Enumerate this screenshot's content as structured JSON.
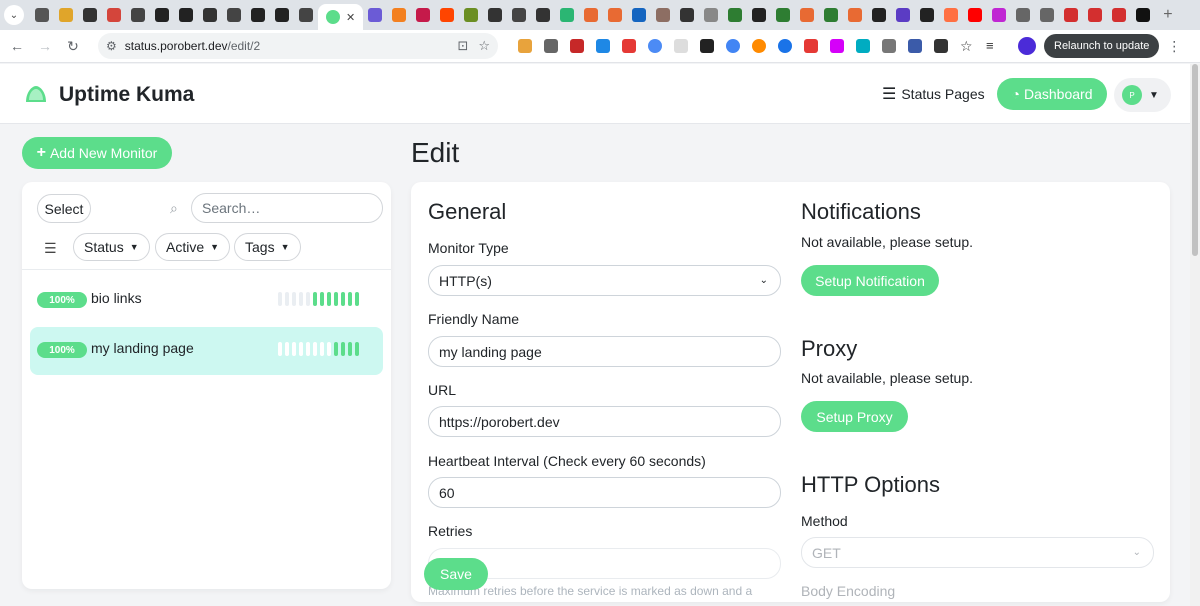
{
  "browser": {
    "tab_close": "✕",
    "url_host": "status.porobert.dev",
    "url_path": "/edit/2",
    "relaunch_label": "Relaunch to update",
    "tab_favicon_colors": [
      "#555",
      "#e0a52a",
      "#333",
      "#d4453b",
      "#444",
      "#222",
      "#222",
      "#333",
      "#444",
      "#222",
      "#222",
      "#444"
    ],
    "extension_colors": [
      "#e8a33c",
      "#666",
      "#c62828",
      "#1e88e5",
      "#e53935",
      "#4c8bf5",
      "#ddd",
      "#222",
      "#4285f4",
      "#ff8a00",
      "#1a73e8",
      "#e53935",
      "#d500f9",
      "#00acc1",
      "#777",
      "#3b5ba9",
      "#333"
    ]
  },
  "header": {
    "app_title": "Uptime Kuma",
    "status_pages_label": "Status Pages",
    "dashboard_label": "Dashboard",
    "avatar_initial": "P"
  },
  "sidebar": {
    "add_monitor_label": "Add New Monitor",
    "select_label": "Select",
    "search_placeholder": "Search…",
    "filters": {
      "status": "Status",
      "active": "Active",
      "tags": "Tags"
    },
    "monitors": [
      {
        "name": "bio links",
        "uptime": "100%",
        "selected": false
      },
      {
        "name": "my landing page",
        "uptime": "100%",
        "selected": true
      }
    ]
  },
  "main": {
    "page_title": "Edit",
    "general": {
      "heading": "General",
      "monitor_type_label": "Monitor Type",
      "monitor_type_value": "HTTP(s)",
      "friendly_name_label": "Friendly Name",
      "friendly_name_value": "my landing page",
      "url_label": "URL",
      "url_value": "https://porobert.dev",
      "interval_label": "Heartbeat Interval (Check every 60 seconds)",
      "interval_value": "60",
      "retries_label": "Retries",
      "retries_help": "Maximum retries before the service is marked as down and a",
      "save_label": "Save"
    },
    "notifications": {
      "heading": "Notifications",
      "note": "Not available, please setup.",
      "button_label": "Setup Notification"
    },
    "proxy": {
      "heading": "Proxy",
      "note": "Not available, please setup.",
      "button_label": "Setup Proxy"
    },
    "http_options": {
      "heading": "HTTP Options",
      "method_label": "Method",
      "method_value": "GET",
      "body_encoding_label": "Body Encoding"
    }
  },
  "colors": {
    "primary": "#5cdd8b",
    "selected_row": "#cdf8f1",
    "background": "#f3f4f6"
  }
}
